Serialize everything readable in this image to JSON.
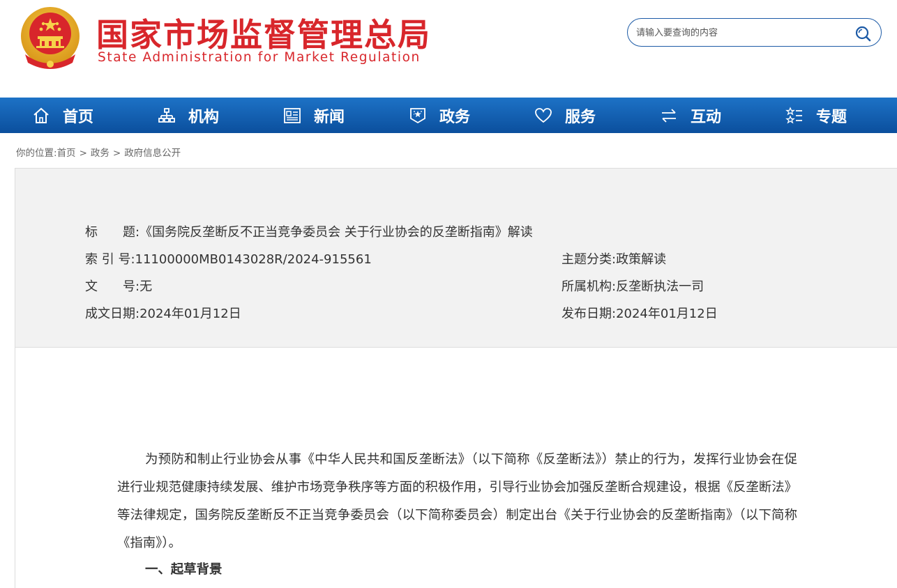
{
  "header": {
    "title_cn": "国家市场监督管理总局",
    "title_en": "State Administration for Market Regulation",
    "emblem_icon": "national-emblem-icon"
  },
  "search": {
    "placeholder": "请输入要查询的内容",
    "button_icon": "search-icon"
  },
  "colors": {
    "brand_red": "#d8262b",
    "nav_blue": "#0b4f9d",
    "nav_blue_light": "#1d72c6",
    "info_bg": "#f2f2f2"
  },
  "nav": {
    "items": [
      {
        "label": "首页",
        "icon": "home-icon"
      },
      {
        "label": "机构",
        "icon": "org-chart-icon"
      },
      {
        "label": "新闻",
        "icon": "news-icon"
      },
      {
        "label": "政务",
        "icon": "government-icon"
      },
      {
        "label": "服务",
        "icon": "heart-icon"
      },
      {
        "label": "互动",
        "icon": "exchange-icon"
      },
      {
        "label": "专题",
        "icon": "topics-icon"
      }
    ]
  },
  "breadcrumb": {
    "prefix": "你的位置:",
    "items": [
      "首页",
      "政务",
      "政府信息公开"
    ],
    "separator": ">"
  },
  "info": {
    "title_label": "标　　题:",
    "title_value": "《国务院反垄断反不正当竞争委员会 关于行业协会的反垄断指南》解读",
    "index_label": "索 引 号:",
    "index_value": "11100000MB0143028R/2024-915561",
    "topic_label": "主题分类:",
    "topic_value": "政策解读",
    "docno_label": "文　　号:",
    "docno_value": "无",
    "org_label": "所属机构:",
    "org_value": "反垄断执法一司",
    "written_label": "成文日期:",
    "written_value": "2024年01月12日",
    "publish_label": "发布日期:",
    "publish_value": "2024年01月12日"
  },
  "article": {
    "paragraph_1": "为预防和制止行业协会从事《中华人民共和国反垄断法》（以下简称《反垄断法》）禁止的行为，发挥行业协会在促进行业规范健康持续发展、维护市场竞争秩序等方面的积极作用，引导行业协会加强反垄断合规建设，根据《反垄断法》等法律规定，国务院反垄断反不正当竞争委员会（以下简称委员会）制定出台《关于行业协会的反垄断指南》（以下简称《指南》）。",
    "section_1": "一、起草背景"
  }
}
